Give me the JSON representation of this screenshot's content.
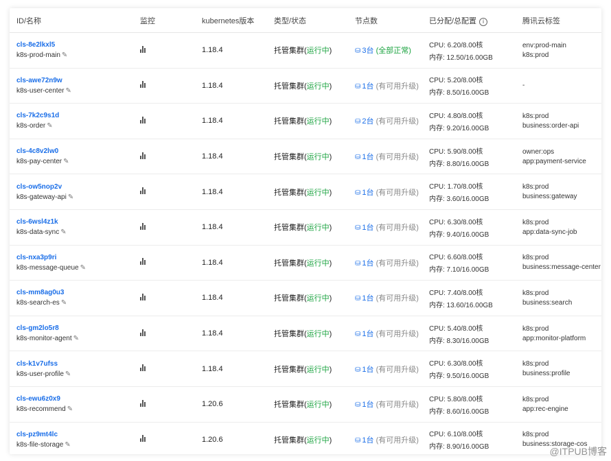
{
  "table": {
    "headers": [
      "ID/名称",
      "监控",
      "kubernetes版本",
      "类型/状态",
      "节点数",
      "已分配/总配置",
      "腾讯云标签"
    ],
    "rows": [
      {
        "id": "cls-8e2lkxl5",
        "name": "k8s-prod-main",
        "version": "1.18.4",
        "type": "托管集群",
        "status": "运行中",
        "nodes": "3台",
        "node_status": "全部正常",
        "cpu": "CPU: 6.20/8.00核",
        "mem": "内存: 12.50/16.00GB",
        "tags": [
          "env:prod-main",
          "k8s:prod"
        ]
      },
      {
        "id": "cls-awe72n9w",
        "name": "k8s-user-center",
        "version": "1.18.4",
        "type": "托管集群",
        "status": "运行中",
        "nodes": "1台",
        "node_status": "有可用升级",
        "cpu": "CPU: 5.20/8.00核",
        "mem": "内存: 8.50/16.00GB",
        "tags": [
          "-"
        ]
      },
      {
        "id": "cls-7k2c9s1d",
        "name": "k8s-order",
        "version": "1.18.4",
        "type": "托管集群",
        "status": "运行中",
        "nodes": "2台",
        "node_status": "有可用升级",
        "cpu": "CPU: 4.80/8.00核",
        "mem": "内存: 9.20/16.00GB",
        "tags": [
          "k8s:prod",
          "business:order-api"
        ]
      },
      {
        "id": "cls-4c8v2lw0",
        "name": "k8s-pay-center",
        "version": "1.18.4",
        "type": "托管集群",
        "status": "运行中",
        "nodes": "1台",
        "node_status": "有可用升级",
        "cpu": "CPU: 5.90/8.00核",
        "mem": "内存: 8.80/16.00GB",
        "tags": [
          "owner:ops",
          "app:payment-service"
        ]
      },
      {
        "id": "cls-ow5nop2v",
        "name": "k8s-gateway-api",
        "version": "1.18.4",
        "type": "托管集群",
        "status": "运行中",
        "nodes": "1台",
        "node_status": "有可用升级",
        "cpu": "CPU: 1.70/8.00核",
        "mem": "内存: 3.60/16.00GB",
        "tags": [
          "k8s:prod",
          "business:gateway"
        ]
      },
      {
        "id": "cls-6wsl4z1k",
        "name": "k8s-data-sync",
        "version": "1.18.4",
        "type": "托管集群",
        "status": "运行中",
        "nodes": "1台",
        "node_status": "有可用升级",
        "cpu": "CPU: 6.30/8.00核",
        "mem": "内存: 9.40/16.00GB",
        "tags": [
          "k8s:prod",
          "app:data-sync-job"
        ]
      },
      {
        "id": "cls-nxa3p9ri",
        "name": "k8s-message-queue",
        "version": "1.18.4",
        "type": "托管集群",
        "status": "运行中",
        "nodes": "1台",
        "node_status": "有可用升级",
        "cpu": "CPU: 6.60/8.00核",
        "mem": "内存: 7.10/16.00GB",
        "tags": [
          "k8s:prod",
          "business:message-center"
        ]
      },
      {
        "id": "cls-mm8ag0u3",
        "name": "k8s-search-es",
        "version": "1.18.4",
        "type": "托管集群",
        "status": "运行中",
        "nodes": "1台",
        "node_status": "有可用升级",
        "cpu": "CPU: 7.40/8.00核",
        "mem": "内存: 13.60/16.00GB",
        "tags": [
          "k8s:prod",
          "business:search"
        ]
      },
      {
        "id": "cls-gm2lo5r8",
        "name": "k8s-monitor-agent",
        "version": "1.18.4",
        "type": "托管集群",
        "status": "运行中",
        "nodes": "1台",
        "node_status": "有可用升级",
        "cpu": "CPU: 5.40/8.00核",
        "mem": "内存: 8.30/16.00GB",
        "tags": [
          "k8s:prod",
          "app:monitor-platform"
        ]
      },
      {
        "id": "cls-k1v7ufss",
        "name": "k8s-user-profile",
        "version": "1.18.4",
        "type": "托管集群",
        "status": "运行中",
        "nodes": "1台",
        "node_status": "有可用升级",
        "cpu": "CPU: 6.30/8.00核",
        "mem": "内存: 9.50/16.00GB",
        "tags": [
          "k8s:prod",
          "business:profile"
        ]
      },
      {
        "id": "cls-ewu6z0x9",
        "name": "k8s-recommend",
        "version": "1.20.6",
        "type": "托管集群",
        "status": "运行中",
        "nodes": "1台",
        "node_status": "有可用升级",
        "cpu": "CPU: 5.80/8.00核",
        "mem": "内存: 8.60/16.00GB",
        "tags": [
          "k8s:prod",
          "app:rec-engine"
        ]
      },
      {
        "id": "cls-pz9mt4lc",
        "name": "k8s-file-storage",
        "version": "1.20.6",
        "type": "托管集群",
        "status": "运行中",
        "nodes": "1台",
        "node_status": "有可用升级",
        "cpu": "CPU: 6.10/8.00核",
        "mem": "内存: 8.90/16.00GB",
        "tags": [
          "k8s:prod",
          "business:storage-cos"
        ]
      }
    ]
  },
  "icons": {
    "monitor": "bar-chart-icon",
    "edit": "edit-pencil-icon",
    "node": "node-icon",
    "info": "info-circle-icon"
  },
  "colors": {
    "link": "#1a6ee8",
    "running": "#1aa33f",
    "muted": "#888888"
  },
  "watermark": "@ITPUB博客"
}
